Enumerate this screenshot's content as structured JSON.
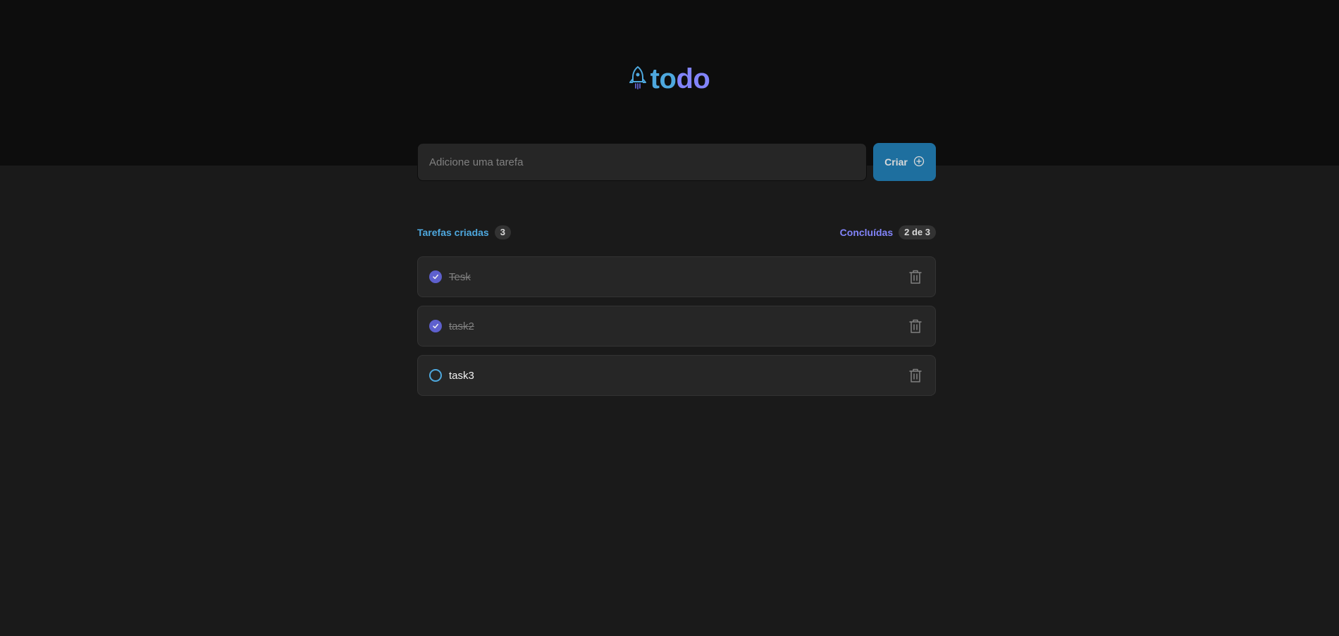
{
  "logo": {
    "part1": "to",
    "part2": "do"
  },
  "new_task": {
    "placeholder": "Adicione uma tarefa",
    "create_label": "Criar"
  },
  "info": {
    "created_label": "Tarefas criadas",
    "created_count": "3",
    "done_label": "Concluídas",
    "done_count": "2 de 3"
  },
  "tasks": [
    {
      "text": "Tesk",
      "done": true
    },
    {
      "text": "task2",
      "done": true
    },
    {
      "text": "task3",
      "done": false
    }
  ],
  "colors": {
    "header_bg": "#0d0d0d",
    "body_bg": "#1a1a1a",
    "blue": "#4ea8de",
    "purple": "#8284fa",
    "button": "#1e6f9f",
    "check_done": "#5e60ce"
  },
  "icons": {
    "logo": "rocket-icon",
    "create": "plus-circle-icon",
    "delete": "trash-icon",
    "done": "check-icon"
  }
}
